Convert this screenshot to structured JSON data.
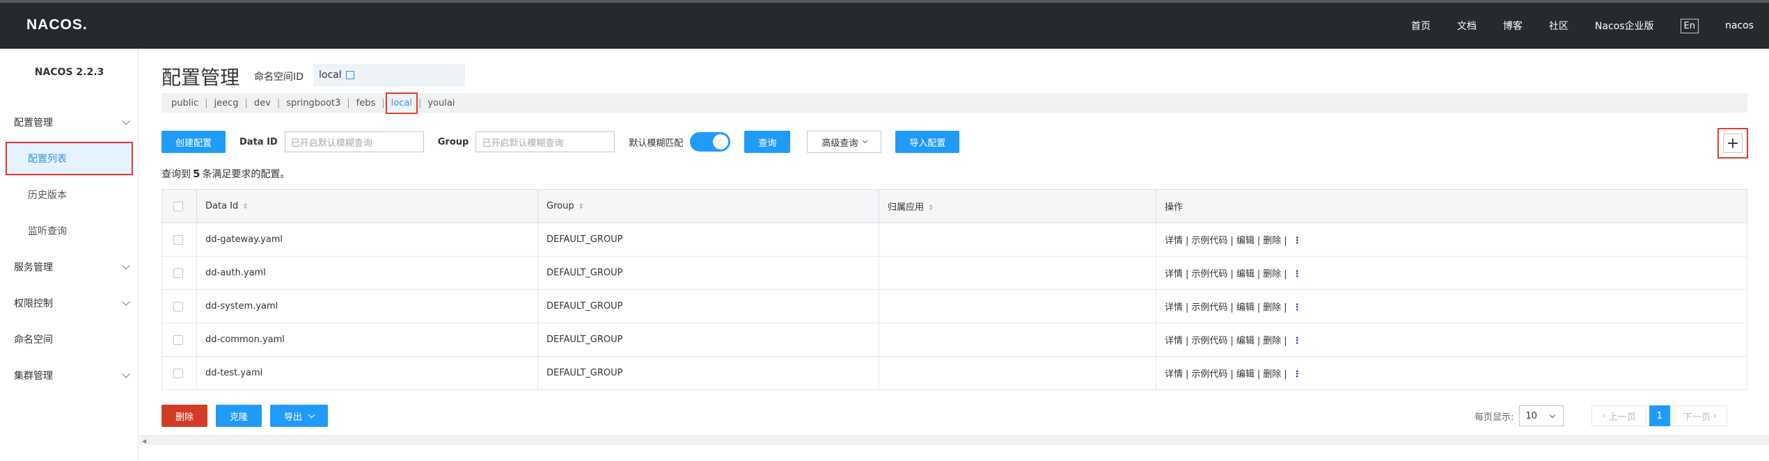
{
  "topbar": {
    "logo": "NACOS.",
    "nav": [
      "首页",
      "文档",
      "博客",
      "社区",
      "Nacos企业版"
    ],
    "lang": "En",
    "user": "nacos"
  },
  "sidebar": {
    "version": "NACOS 2.2.3",
    "items": [
      {
        "label": "配置管理",
        "type": "group"
      },
      {
        "label": "配置列表",
        "type": "sub",
        "active": true
      },
      {
        "label": "历史版本",
        "type": "sub"
      },
      {
        "label": "监听查询",
        "type": "sub"
      },
      {
        "label": "服务管理",
        "type": "group"
      },
      {
        "label": "权限控制",
        "type": "group"
      },
      {
        "label": "命名空间",
        "type": "item"
      },
      {
        "label": "集群管理",
        "type": "group"
      }
    ]
  },
  "main": {
    "title": "配置管理",
    "namespace_id_label": "命名空间ID",
    "namespace_id_value": "local",
    "namespaces": [
      "public",
      "jeecg",
      "dev",
      "springboot3",
      "febs",
      "local",
      "youlai"
    ],
    "active_namespace": "local",
    "toolbar": {
      "create_label": "创建配置",
      "data_id_label": "Data ID",
      "data_id_placeholder": "已开启默认模糊查询",
      "group_label": "Group",
      "group_placeholder": "已开启默认模糊查询",
      "fuzzy_label": "默认模糊匹配",
      "search_label": "查询",
      "advanced_label": "高级查询",
      "import_label": "导入配置",
      "plus": "+"
    },
    "summary_prefix": "查询到",
    "summary_count": "5",
    "summary_suffix": "条满足要求的配置。",
    "table": {
      "headers": [
        "Data Id",
        "Group",
        "归属应用",
        "操作"
      ],
      "rows": [
        {
          "data_id": "dd-gateway.yaml",
          "group": "DEFAULT_GROUP",
          "app": ""
        },
        {
          "data_id": "dd-auth.yaml",
          "group": "DEFAULT_GROUP",
          "app": ""
        },
        {
          "data_id": "dd-system.yaml",
          "group": "DEFAULT_GROUP",
          "app": ""
        },
        {
          "data_id": "dd-common.yaml",
          "group": "DEFAULT_GROUP",
          "app": ""
        },
        {
          "data_id": "dd-test.yaml",
          "group": "DEFAULT_GROUP",
          "app": ""
        }
      ],
      "ops": [
        "详情",
        "示例代码",
        "编辑",
        "删除"
      ]
    },
    "bottom": {
      "delete_label": "删除",
      "clone_label": "克隆",
      "export_label": "导出"
    },
    "pager": {
      "per_page_label": "每页显示:",
      "per_page_value": "10",
      "prev_label": "上一页",
      "page": "1",
      "next_label": "下一页"
    }
  },
  "colors": {
    "primary": "#209bfa",
    "danger": "#d23c26",
    "topbar": "#252a2f",
    "highlight_border": "#e53a2f"
  }
}
